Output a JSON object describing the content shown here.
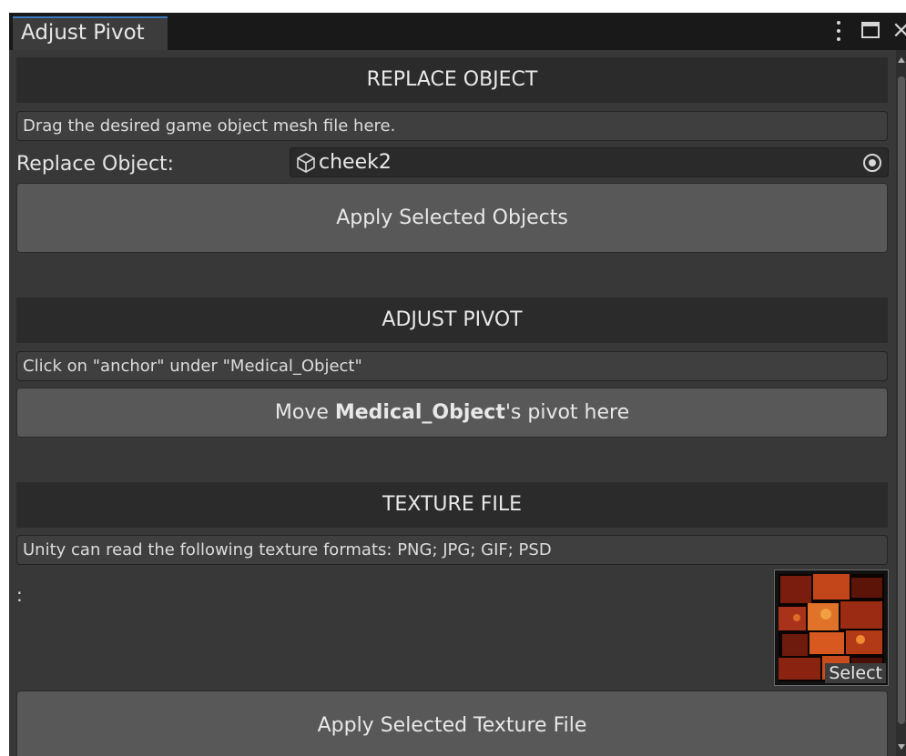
{
  "window": {
    "tab_title": "Adjust Pivot"
  },
  "replace_section": {
    "header": "REPLACE OBJECT",
    "help": "Drag the desired game object mesh file here.",
    "field_label": "Replace Object:",
    "field_value": "cheek2",
    "field_icon": "mesh-cube-icon",
    "apply_button": "Apply Selected Objects"
  },
  "pivot_section": {
    "header": "ADJUST PIVOT",
    "help": "Click on  \"anchor\" under \"Medical_Object\"",
    "move_button_prefix": "Move ",
    "move_button_bold": "Medical_Object",
    "move_button_suffix": "'s pivot here"
  },
  "texture_section": {
    "header": "TEXTURE FILE",
    "help": "Unity can read the following texture formats: PNG; JPG; GIF; PSD",
    "field_label": ":",
    "select_label": "Select",
    "apply_button": "Apply Selected Texture File"
  },
  "colors": {
    "accent": "#3a79bb",
    "panel": "#383838",
    "header_bg": "#2b2b2b",
    "button_bg": "#585858"
  }
}
